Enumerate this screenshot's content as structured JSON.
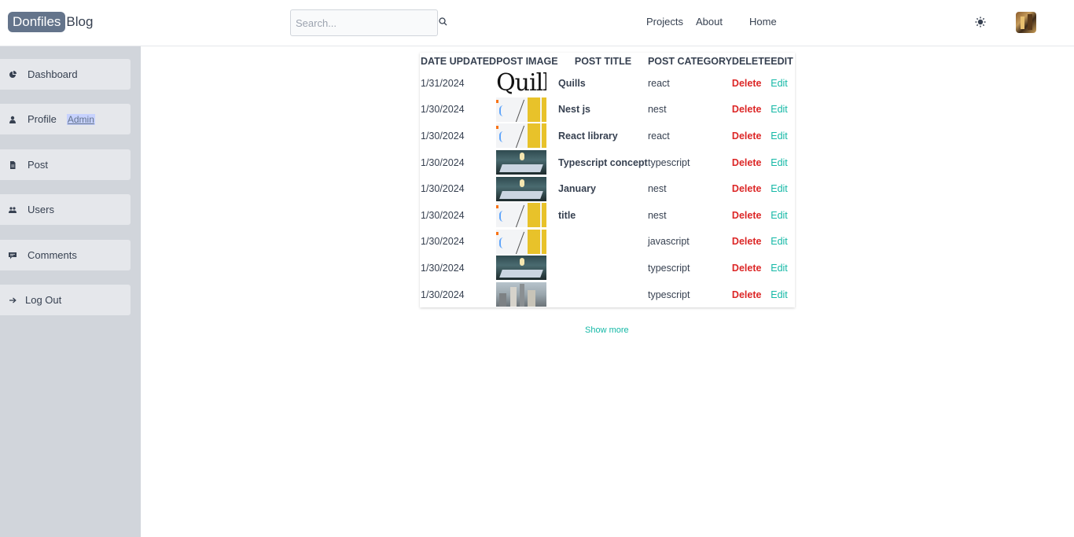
{
  "header": {
    "logo_badge": "Donfiles",
    "logo_text": "Blog",
    "search_placeholder": "Search...",
    "nav": {
      "projects": "Projects",
      "about": "About",
      "home": "Home"
    }
  },
  "sidebar": {
    "items": [
      {
        "label": "Dashboard",
        "icon": "pie-chart-icon"
      },
      {
        "label": "Profile",
        "icon": "user-icon",
        "tag": "Admin"
      },
      {
        "label": "Post",
        "icon": "document-icon"
      },
      {
        "label": "Users",
        "icon": "users-icon"
      },
      {
        "label": "Comments",
        "icon": "comment-icon"
      },
      {
        "label": "Log Out",
        "icon": "arrow-right-icon"
      }
    ]
  },
  "table": {
    "headers": [
      "Date updated",
      "Post image",
      "Post title",
      "Post category",
      "Delete",
      "Edit"
    ],
    "rows": [
      {
        "date": "1/31/2024",
        "image": "quill-logo",
        "title": "Quills",
        "category": "react",
        "delete": "Delete",
        "edit": "Edit"
      },
      {
        "date": "1/30/2024",
        "image": "js-code",
        "title": "Nest js",
        "category": "nest",
        "delete": "Delete",
        "edit": "Edit"
      },
      {
        "date": "1/30/2024",
        "image": "js-code",
        "title": "React library",
        "category": "react",
        "delete": "Delete",
        "edit": "Edit"
      },
      {
        "date": "1/30/2024",
        "image": "laptop",
        "title": "Typescript concept",
        "category": "typescript",
        "delete": "Delete",
        "edit": "Edit"
      },
      {
        "date": "1/30/2024",
        "image": "laptop",
        "title": "January",
        "category": "nest",
        "delete": "Delete",
        "edit": "Edit"
      },
      {
        "date": "1/30/2024",
        "image": "js-code",
        "title": "title",
        "category": "nest",
        "delete": "Delete",
        "edit": "Edit"
      },
      {
        "date": "1/30/2024",
        "image": "js-code",
        "title": "",
        "category": "javascript",
        "delete": "Delete",
        "edit": "Edit"
      },
      {
        "date": "1/30/2024",
        "image": "laptop",
        "title": "",
        "category": "typescript",
        "delete": "Delete",
        "edit": "Edit"
      },
      {
        "date": "1/30/2024",
        "image": "city",
        "title": "",
        "category": "typescript",
        "delete": "Delete",
        "edit": "Edit"
      }
    ]
  },
  "show_more": "Show more",
  "quill_logo_text": "Quill",
  "colors": {
    "accent": "#14b8a6",
    "danger": "#dc2626",
    "sidebar": "#d1d5db",
    "badge": "#64748b"
  }
}
